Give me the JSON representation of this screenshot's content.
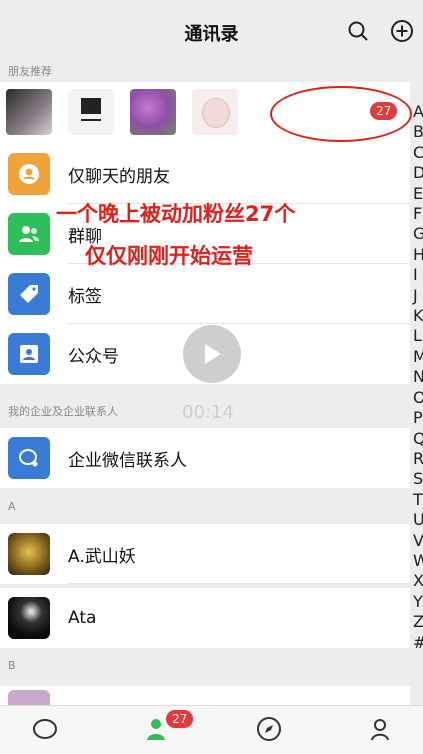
{
  "header": {
    "title": "通讯录"
  },
  "sections": {
    "friend_recommend": "朋友推荐",
    "enterprise": "我的企业及企业联系人",
    "letter_a": "A",
    "letter_b": "B"
  },
  "friend_strip": {
    "badge_count": "27"
  },
  "rows": {
    "chat_only_friends": "仅聊天的朋友",
    "group_chats": "群聊",
    "tags": "标签",
    "official_accounts": "公众号",
    "wecom_contacts": "企业微信联系人",
    "contact_1": "A.武山妖",
    "contact_2": "Ata"
  },
  "overlay": {
    "line1": "一个晚上被动加粉丝27个",
    "line2": "仅仅刚刚开始运营"
  },
  "video": {
    "time": "00:14"
  },
  "index_letters": [
    "A",
    "B",
    "C",
    "D",
    "E",
    "F",
    "G",
    "H",
    "I",
    "J",
    "K",
    "L",
    "M",
    "N",
    "O",
    "P",
    "Q",
    "R",
    "S",
    "T",
    "U",
    "V",
    "W",
    "X",
    "Y",
    "Z",
    "#"
  ],
  "tabbar": {
    "contacts_badge": "27"
  },
  "colors": {
    "accent_red": "#e0201b",
    "badge_red": "#e23b3b",
    "icon_orange": "#f0a33b",
    "icon_green": "#2fbf5a",
    "icon_blue": "#3a7bd5"
  }
}
